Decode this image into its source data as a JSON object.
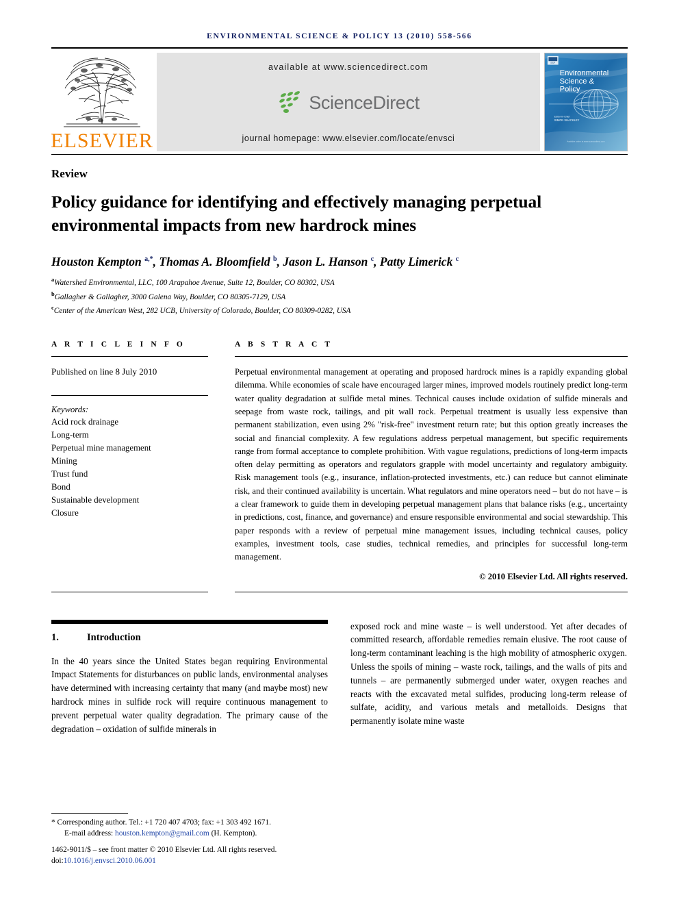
{
  "running_head": "ENVIRONMENTAL SCIENCE & POLICY 13 (2010) 558-566",
  "banner": {
    "elsevier_wordmark": "ELSEVIER",
    "available_at": "available at www.sciencedirect.com",
    "sciencedirect_word": "ScienceDirect",
    "journal_homepage": "journal homepage: www.elsevier.com/locate/envsci",
    "cover": {
      "line1": "Environmental",
      "line2": "Science &",
      "line3": "Policy",
      "editor_label": "Editor-in-Chief",
      "editor_name": "SIMON SHACKLEY"
    }
  },
  "article": {
    "type_label": "Review",
    "title": "Policy guidance for identifying and effectively managing perpetual environmental impacts from new hardrock mines",
    "authors_html": "Houston Kempton <sup>a,*</sup>, Thomas A. Bloomfield <sup>b</sup>, Jason L. Hanson <sup>c</sup>, Patty Limerick <sup>c</sup>",
    "affiliations": [
      {
        "marker": "a",
        "text": "Watershed Environmental, LLC, 100 Arapahoe Avenue, Suite 12, Boulder, CO 80302, USA"
      },
      {
        "marker": "b",
        "text": "Gallagher & Gallagher, 3000 Galena Way, Boulder, CO 80305-7129, USA"
      },
      {
        "marker": "c",
        "text": "Center of the American West, 282 UCB, University of Colorado, Boulder, CO 80309-0282, USA"
      }
    ]
  },
  "info": {
    "heading": "A R T I C L E   I N F O",
    "published": "Published on line 8 July 2010",
    "keywords_label": "Keywords:",
    "keywords": [
      "Acid rock drainage",
      "Long-term",
      "Perpetual mine management",
      "Mining",
      "Trust fund",
      "Bond",
      "Sustainable development",
      "Closure"
    ]
  },
  "abstract": {
    "heading": "A B S T R A C T",
    "text": "Perpetual environmental management at operating and proposed hardrock mines is a rapidly expanding global dilemma. While economies of scale have encouraged larger mines, improved models routinely predict long-term water quality degradation at sulfide metal mines. Technical causes include oxidation of sulfide minerals and seepage from waste rock, tailings, and pit wall rock. Perpetual treatment is usually less expensive than permanent stabilization, even using 2% ''risk-free'' investment return rate; but this option greatly increases the social and financial complexity. A few regulations address perpetual management, but specific requirements range from formal acceptance to complete prohibition. With vague regulations, predictions of long-term impacts often delay permitting as operators and regulators grapple with model uncertainty and regulatory ambiguity. Risk management tools (e.g., insurance, inflation-protected investments, etc.) can reduce but cannot eliminate risk, and their continued availability is uncertain. What regulators and mine operators need – but do not have – is a clear framework to guide them in developing perpetual management plans that balance risks (e.g., uncertainty in predictions, cost, finance, and governance) and ensure responsible environmental and social stewardship. This paper responds with a review of perpetual mine management issues, including technical causes, policy examples, investment tools, case studies, technical remedies, and principles for successful long-term management.",
    "copyright": "© 2010 Elsevier Ltd. All rights reserved."
  },
  "body": {
    "section_number": "1.",
    "section_title": "Introduction",
    "left_paragraph": "In the 40 years since the United States began requiring Environmental Impact Statements for disturbances on public lands, environmental analyses have determined with increasing certainty that many (and maybe most) new hardrock mines in sulfide rock will require continuous management to prevent perpetual water quality degradation. The primary cause of the degradation – oxidation of sulfide minerals in",
    "right_paragraph": "exposed rock and mine waste – is well understood. Yet after decades of committed research, affordable remedies remain elusive. The root cause of long-term contaminant leaching is the high mobility of atmospheric oxygen. Unless the spoils of mining – waste rock, tailings, and the walls of pits and tunnels – are permanently submerged under water, oxygen reaches and reacts with the excavated metal sulfides, producing long-term release of sulfate, acidity, and various metals and metalloids. Designs that permanently isolate mine waste"
  },
  "footnote": {
    "corresponding": "* Corresponding author. Tel.: +1 720 407 4703; fax: +1 303 492 1671.",
    "email_label": "E-mail address:",
    "email": "houston.kempton@gmail.com",
    "email_suffix": "(H. Kempton).",
    "issn_line": "1462-9011/$ – see front matter © 2010 Elsevier Ltd. All rights reserved.",
    "doi_label": "doi:",
    "doi": "10.1016/j.envsci.2010.06.001"
  },
  "colors": {
    "runhead": "#0d1b5e",
    "elsevier_orange": "#f08000",
    "sciencedirect_green": "#5aab47",
    "sciencedirect_gray": "#6d6e70",
    "link_blue": "#2448a8",
    "cover_blue": "#1f6fb2"
  }
}
